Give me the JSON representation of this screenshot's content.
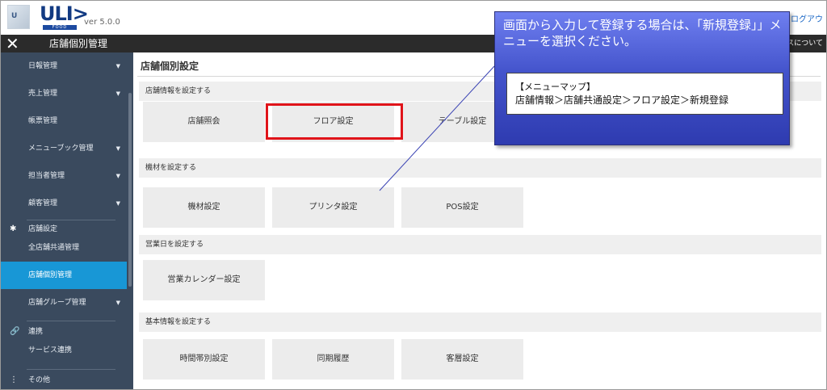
{
  "header": {
    "brand": "ULI>",
    "brand_sub": "FOOD",
    "version": "ver 5.0.0",
    "logout": "➜ ログアウ"
  },
  "titlebar": {
    "close": "✕",
    "title": "店舗個別管理",
    "about": "スについて"
  },
  "sidebar": {
    "items": [
      {
        "label": "日報管理",
        "caret": "▼"
      },
      {
        "label": "売上管理",
        "caret": "▼"
      },
      {
        "label": "帳票管理",
        "caret": ""
      },
      {
        "label": "メニューブック管理",
        "caret": "▼"
      },
      {
        "label": "担当者管理",
        "caret": "▼"
      },
      {
        "label": "顧客管理",
        "caret": "▼"
      }
    ],
    "store_section": {
      "icon": "✱",
      "label": "店舗設定"
    },
    "store_items": [
      {
        "label": "全店舗共通管理"
      },
      {
        "label": "店舗個別管理"
      },
      {
        "label": "店舗グループ管理",
        "caret": "▼"
      }
    ],
    "link_section": {
      "icon": "🔗",
      "label": "連携"
    },
    "link_items": [
      {
        "label": "サービス連携"
      }
    ],
    "other_section": {
      "icon": "⋮",
      "label": "その他"
    }
  },
  "main": {
    "page_title": "店舗個別設定",
    "sections": [
      {
        "title": "店舗情報を設定する",
        "tiles": [
          "店舗照会",
          "フロア設定",
          "テーブル設定"
        ]
      },
      {
        "title": "機材を設定する",
        "tiles": [
          "機材設定",
          "プリンタ設定",
          "POS設定"
        ]
      },
      {
        "title": "営業日を設定する",
        "tiles": [
          "営業カレンダー設定"
        ]
      },
      {
        "title": "基本情報を設定する",
        "tiles": [
          "時間帯別設定",
          "同期履歴",
          "客層設定"
        ]
      }
    ]
  },
  "callout": {
    "text": "画面から入力して登録する場合は、「新規登録」」メニューを選択ください。",
    "map_title": "【メニューマップ】",
    "map_path": "店舗情報＞店舗共通設定＞フロア設定＞新規登録"
  },
  "colors": {
    "sidebar_bg": "#3a4a5e",
    "active_item": "#1897d6",
    "titlebar_bg": "#2b2b2b",
    "highlight": "#e0141a",
    "callout_bg": "#4454cc"
  }
}
